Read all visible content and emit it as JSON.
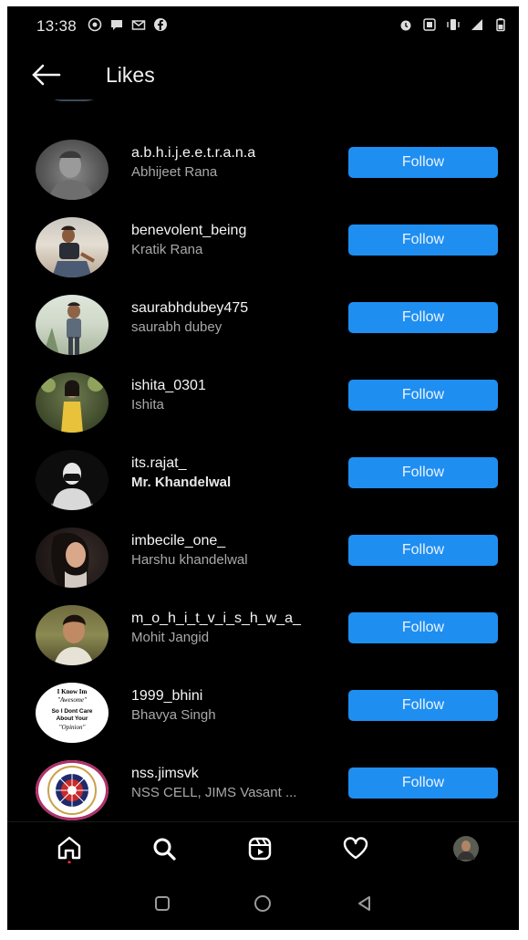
{
  "status_bar": {
    "time": "13:38"
  },
  "header": {
    "title": "Likes"
  },
  "colors": {
    "follow_button": "#1f8ef1",
    "background": "#000000"
  },
  "likes": [
    {
      "username": "a.b.h.i.j.e.e.t.r.a.n.a",
      "full_name": "Abhijeet Rana",
      "button": "Follow",
      "bold_name": false
    },
    {
      "username": "benevolent_being",
      "full_name": "Kratik Rana",
      "button": "Follow",
      "bold_name": false
    },
    {
      "username": "saurabhdubey475",
      "full_name": "saurabh dubey",
      "button": "Follow",
      "bold_name": false
    },
    {
      "username": "ishita_0301",
      "full_name": "Ishita",
      "button": "Follow",
      "bold_name": false
    },
    {
      "username": "its.rajat_",
      "full_name": "Mr. Khandelwal",
      "button": "Follow",
      "bold_name": true
    },
    {
      "username": "imbecile_one_",
      "full_name": "Harshu  khandelwal",
      "button": "Follow",
      "bold_name": false
    },
    {
      "username": "m_o_h_i_t_v_i_s_h_w_a_",
      "full_name": "Mohit Jangid",
      "button": "Follow",
      "bold_name": false
    },
    {
      "username": "1999_bhini",
      "full_name": "Bhavya Singh",
      "button": "Follow",
      "bold_name": false
    },
    {
      "username": "nss.jimsvk",
      "full_name": "NSS CELL, JIMS Vasant ...",
      "button": "Follow",
      "bold_name": false
    }
  ],
  "avatars": {
    "bhini_text": [
      "I Know Im",
      "Awesome",
      "So I Dont Care",
      "About Your",
      "Opinion"
    ]
  },
  "bottom_nav": [
    "home-icon",
    "search-icon",
    "reels-icon",
    "heart-icon",
    "profile-avatar"
  ],
  "system_nav": [
    "recents-icon",
    "home-circle-icon",
    "back-triangle-icon"
  ]
}
